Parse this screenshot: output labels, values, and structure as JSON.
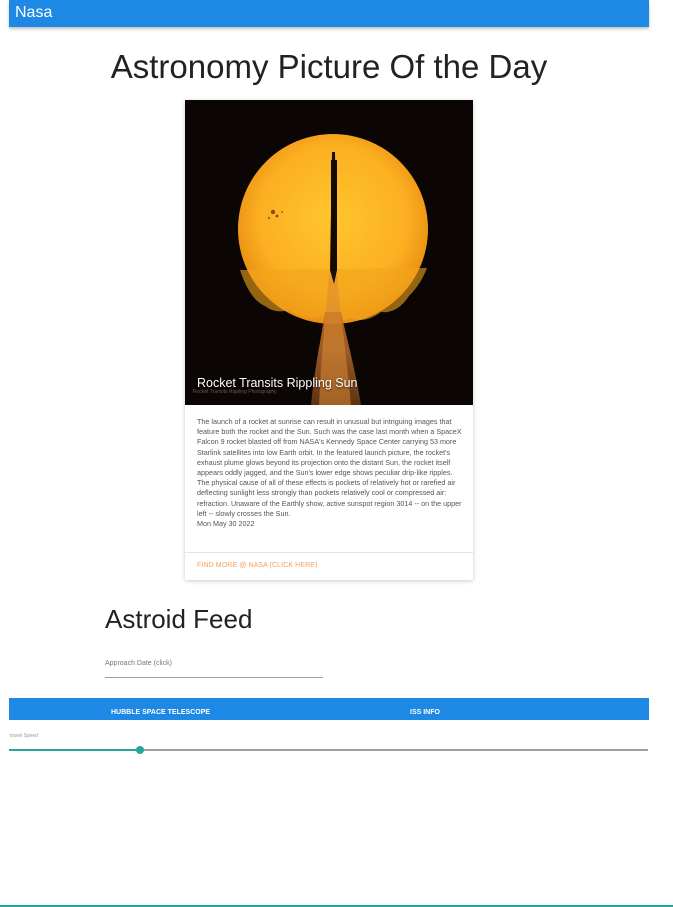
{
  "nav": {
    "brand": "Nasa"
  },
  "page_title": "Astronomy Picture Of the Day",
  "apod": {
    "image_title": "Rocket Transits Rippling Sun",
    "image_credit": "Rocket Transits\nRippling Photography",
    "description": "The launch of a rocket at sunrise can result in unusual but intriguing images that feature both the rocket and the Sun. Such was the case last month when a SpaceX Falcon 9 rocket blasted off from NASA's Kennedy Space Center carrying 53 more Starlink satellites into low Earth orbit. In the featured launch picture, the rocket's exhaust plume glows beyond its projection onto the distant Sun, the rocket itself appears oddly jagged, and the Sun's lower edge shows peculiar drip-like ripples. The physical cause of all of these effects is pockets of relatively hot or rarefied air deflecting sunlight less strongly than pockets relatively cool or compressed air: refraction. Unaware of the Earthly show, active sunspot region 3014 -- on the upper left -- slowly crosses the Sun.",
    "date": "Mon May 30 2022",
    "link_label": "FIND MORE @ NASA (CLICK HERE)"
  },
  "asteroid": {
    "title": "Astroid Feed",
    "date_placeholder": "Approach Date (click)"
  },
  "tabs": [
    {
      "label": "HUBBLE SPACE TELESCOPE"
    },
    {
      "label": "ISS INFO"
    }
  ],
  "slider": {
    "label": "travel Speed",
    "value_fraction": 0.205
  },
  "colors": {
    "primary": "#1e88e5",
    "accent": "#26a69a",
    "link": "#f5a05a"
  }
}
